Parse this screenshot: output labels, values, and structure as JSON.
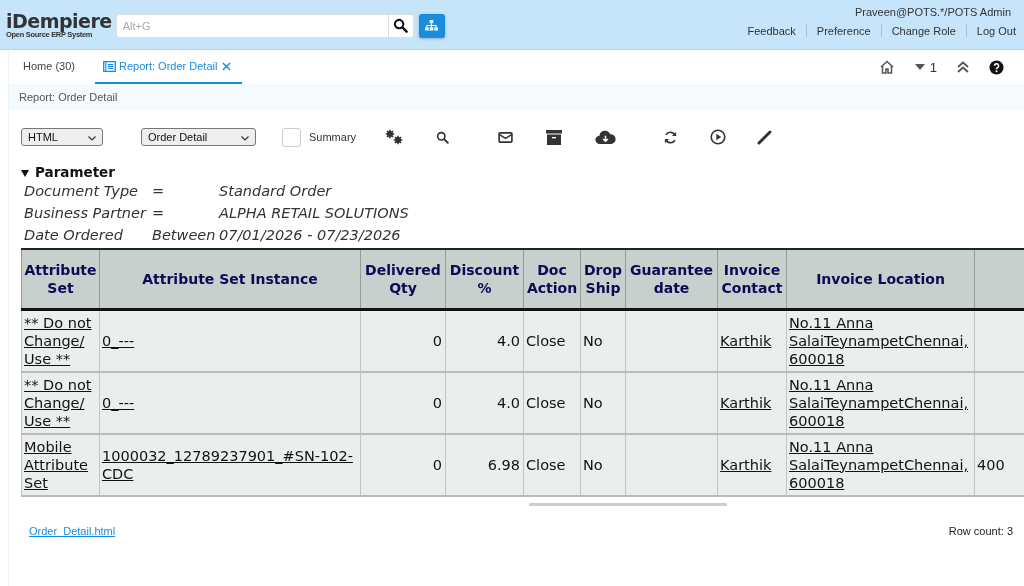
{
  "header": {
    "logo": {
      "title": "iDempiere",
      "subtitle": "Open Source ERP System"
    },
    "search": {
      "placeholder": "Alt+G"
    },
    "user": "Praveen@POTS.*/POTS Admin",
    "links": [
      "Feedback",
      "Preference",
      "Change Role",
      "Log Out"
    ]
  },
  "tabs": [
    {
      "label": "Home (30)",
      "kind": "home",
      "selected": false
    },
    {
      "label": "Report: Order Detail",
      "kind": "report",
      "selected": true
    }
  ],
  "tab_tools": {
    "count": "1"
  },
  "breadcrumb": "Report: Order Detail",
  "report_toolbar": {
    "format": "HTML",
    "print_format": "Order Detail",
    "summary": {
      "label": "Summary",
      "checked": false
    }
  },
  "parameters": {
    "title": "Parameter",
    "expanded": true,
    "rows": [
      {
        "name": "Document Type",
        "operator": "=",
        "value": "Standard Order"
      },
      {
        "name": "Business Partner",
        "operator": "=",
        "value": "ALPHA RETAIL SOLUTIONS"
      },
      {
        "name": "Date Ordered",
        "operator": "Between",
        "value": "07/01/2026 - 07/23/2026"
      }
    ]
  },
  "table": {
    "columns": [
      {
        "label": "Attribute Set",
        "kind": "text"
      },
      {
        "label": "Attribute Set Instance",
        "kind": "text"
      },
      {
        "label": "Delivered Qty",
        "kind": "number"
      },
      {
        "label": "Discount %",
        "kind": "number"
      },
      {
        "label": "Doc Action",
        "kind": "text"
      },
      {
        "label": "Drop Ship",
        "kind": "text"
      },
      {
        "label": "Guarantee date",
        "kind": "text"
      },
      {
        "label": "Invoice Contact",
        "kind": "text"
      },
      {
        "label": "Invoice Location",
        "kind": "text"
      },
      {
        "kind": "text"
      }
    ],
    "rows": [
      [
        {
          "text": "** Do not Change/ Use **",
          "link": true
        },
        {
          "text": "0_---",
          "link": true
        },
        {
          "text": "0"
        },
        {
          "text": "4.0"
        },
        {
          "text": "Close"
        },
        {
          "text": "No"
        },
        {},
        {
          "text": "Karthik",
          "link": true
        },
        {
          "text": "No.11 Anna SalaiTeynampetChennai, 600018",
          "link": true
        },
        {}
      ],
      [
        {
          "text": "** Do not Change/ Use **",
          "link": true
        },
        {
          "text": "0_---",
          "link": true
        },
        {
          "text": "0"
        },
        {
          "text": "4.0"
        },
        {
          "text": "Close"
        },
        {
          "text": "No"
        },
        {},
        {
          "text": "Karthik",
          "link": true
        },
        {
          "text": "No.11 Anna SalaiTeynampetChennai, 600018",
          "link": true
        },
        {}
      ],
      [
        {
          "text": "Mobile Attribute Set",
          "link": true
        },
        {
          "text": "1000032_12789237901_#SN-102-CDC",
          "link": true
        },
        {
          "text": "0"
        },
        {
          "text": "6.98"
        },
        {
          "text": "Close"
        },
        {
          "text": "No"
        },
        {},
        {
          "text": "Karthik",
          "link": true
        },
        {
          "text": "No.11 Anna SalaiTeynampetChennai, 600018",
          "link": true
        },
        {
          "text": "400"
        }
      ]
    ]
  },
  "footer": {
    "file_link": "Order_Detail.html",
    "row_count": "Row count: 3"
  }
}
